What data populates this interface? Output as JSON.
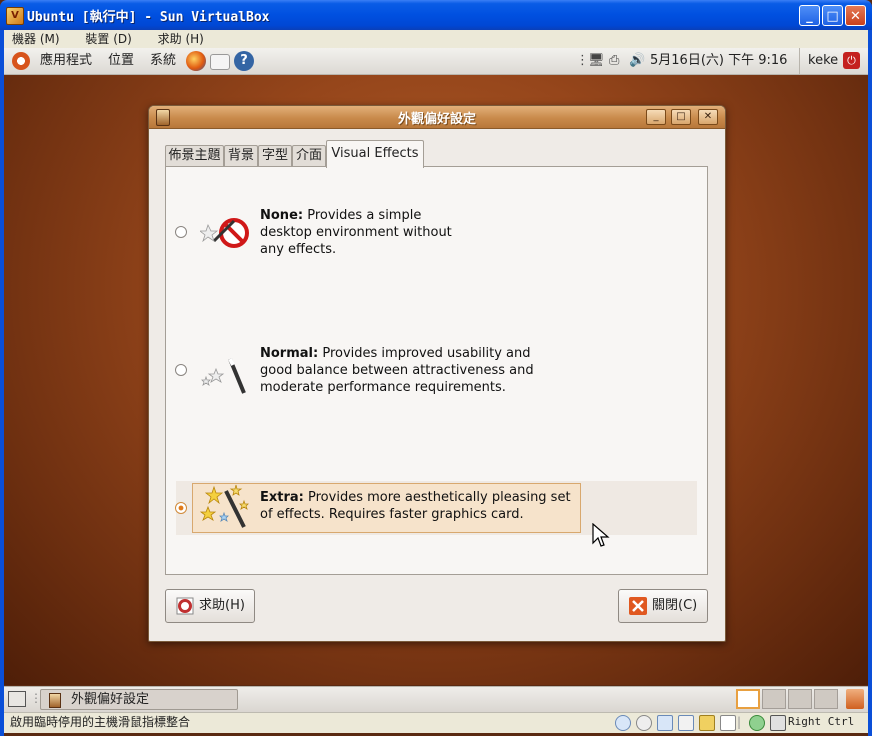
{
  "host": {
    "title": "Ubuntu [執行中] - Sun VirtualBox",
    "menu": [
      "機器 (M)",
      "裝置 (D)",
      "求助 (H)"
    ],
    "status_text": "啟用臨時停用的主機滑鼠指標整合",
    "host_key": "Right Ctrl"
  },
  "top_panel": {
    "menus": [
      "應用程式",
      "位置",
      "系統"
    ],
    "clock": "5月16日(六) 下午  9:16",
    "user": "keke"
  },
  "dialog": {
    "title": "外觀偏好設定",
    "tabs": [
      "佈景主題",
      "背景",
      "字型",
      "介面",
      "Visual Effects"
    ],
    "active_tab": "Visual Effects",
    "options": [
      {
        "title": "None:",
        "text_l1": "Provides a simple",
        "text_l2": "desktop environment without",
        "text_l3": "any effects.",
        "selected": false
      },
      {
        "title": "Normal:",
        "text_l1": "Provides improved usability and",
        "text_l2": "good balance between attractiveness and",
        "text_l3": "moderate performance requirements.",
        "selected": false
      },
      {
        "title": "Extra:",
        "text_l1": "Provides more aesthetically pleasing set",
        "text_l2": "of effects. Requires faster graphics card.",
        "text_l3": "",
        "selected": true
      }
    ],
    "help_button": "求助(H)",
    "close_button": "關閉(C)"
  },
  "bottom_panel": {
    "task": "外觀偏好設定",
    "workspaces": 4,
    "active_workspace": 1
  },
  "colors": {
    "accent": "#e07a1a",
    "host_blue": "#0050e0",
    "dialog_title": "#c98a4b"
  }
}
